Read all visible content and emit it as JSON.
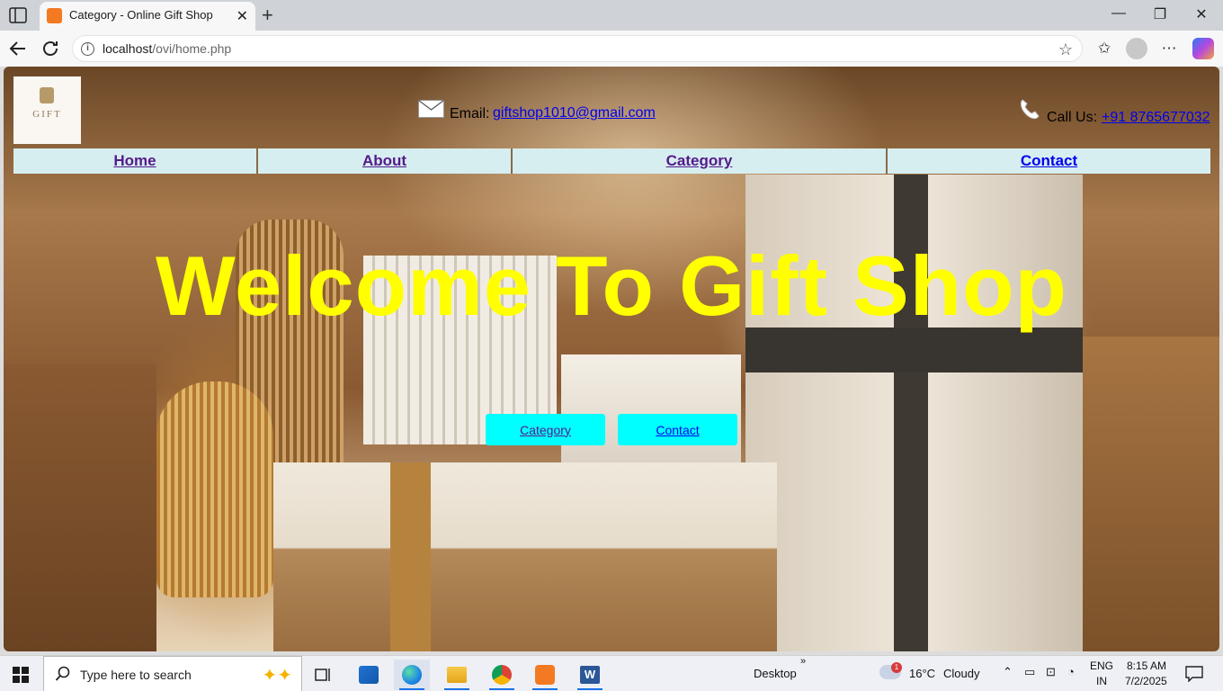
{
  "browser": {
    "tab_title": "Category - Online Gift Shop",
    "url_host": "localhost",
    "url_path": "/ovi/home.php"
  },
  "site": {
    "logo_text": "GIFT",
    "email_label": "Email:",
    "email": "giftshop1010@gmail.com",
    "call_label": "Call Us:",
    "phone": "+91 8765677032",
    "nav": [
      {
        "label": "Home"
      },
      {
        "label": "About"
      },
      {
        "label": "Category"
      },
      {
        "label": "Contact"
      }
    ],
    "hero_title": "Welcome To Gift Shop",
    "buttons": [
      {
        "label": "Category"
      },
      {
        "label": "Contact"
      }
    ],
    "colors": {
      "hero_title": "#ffff00",
      "nav_bg": "#d6eef0",
      "button_bg": "#00ffff",
      "link_visited": "#551a8b",
      "link": "#0000ee"
    }
  },
  "taskbar": {
    "search_placeholder": "Type here to search",
    "desktop_label": "Desktop",
    "weather_badge": "1",
    "temperature": "16°C",
    "weather": "Cloudy",
    "lang_line1": "ENG",
    "lang_line2": "IN",
    "time": "8:15 AM",
    "date": "7/2/2025"
  }
}
